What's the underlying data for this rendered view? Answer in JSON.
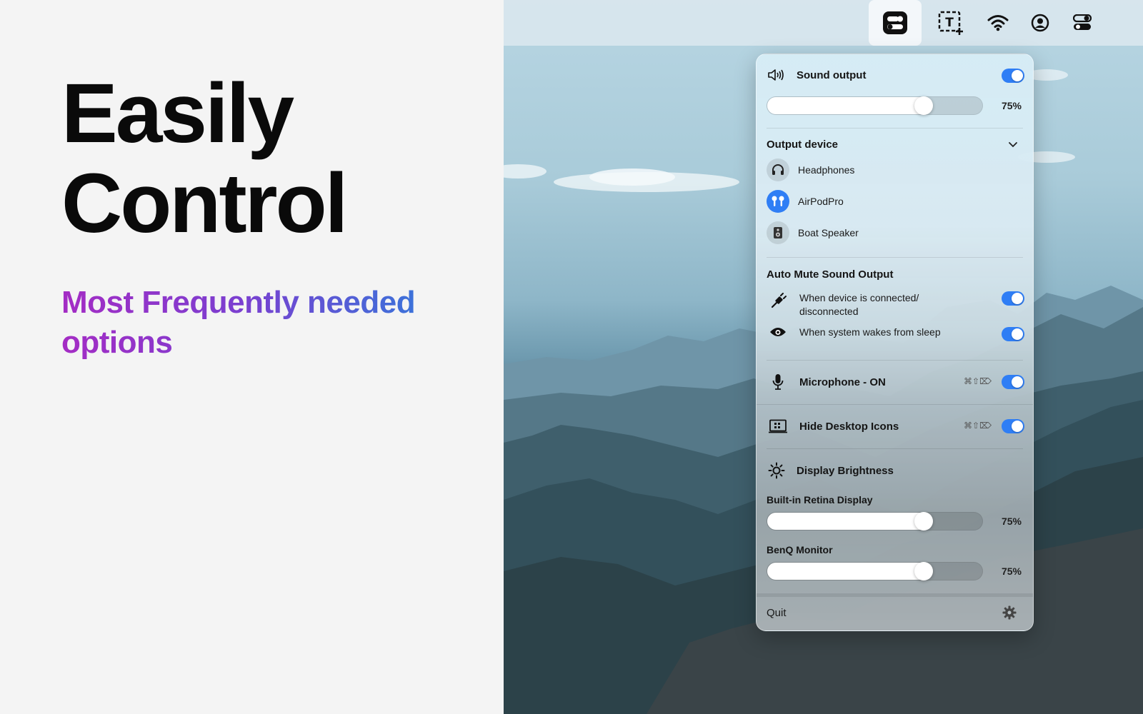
{
  "hero": {
    "headline_line1": "Easily",
    "headline_line2": "Control",
    "subheadline": "Most Frequently needed options"
  },
  "menubar": {
    "icons": [
      "control-center-app-icon",
      "text-capture-icon",
      "wifi-icon",
      "user-account-icon",
      "toggles-icon"
    ]
  },
  "panel": {
    "sound": {
      "title": "Sound output",
      "enabled": true,
      "volume": 75,
      "volume_label": "75%"
    },
    "output_device": {
      "title": "Output device",
      "devices": [
        {
          "label": "Headphones",
          "icon": "headphones-icon",
          "selected": false
        },
        {
          "label": "AirPodPro",
          "icon": "airpods-icon",
          "selected": true
        },
        {
          "label": "Boat Speaker",
          "icon": "speaker-icon",
          "selected": false
        }
      ]
    },
    "auto_mute": {
      "title": "Auto Mute Sound Output",
      "options": [
        {
          "label_line1": "When device is connected/",
          "label_line2": "disconnected",
          "enabled": true
        },
        {
          "label": "When system wakes from sleep",
          "enabled": true
        }
      ]
    },
    "microphone": {
      "label": "Microphone - ON",
      "shortcut": "⌘⇧⌦",
      "enabled": true
    },
    "hide_icons": {
      "label": "Hide Desktop Icons",
      "shortcut": "⌘⇧⌦",
      "enabled": true
    },
    "brightness": {
      "title": "Display Brightness",
      "displays": [
        {
          "label": "Built-in Retina Display",
          "value": 75,
          "value_label": "75%"
        },
        {
          "label": "BenQ Monitor",
          "value": 75,
          "value_label": "75%"
        }
      ]
    },
    "footer": {
      "quit_label": "Quit"
    }
  },
  "colors": {
    "accent": "#2f7ef5",
    "gradient_start": "#a42cc4",
    "gradient_end": "#2b7fdc"
  }
}
